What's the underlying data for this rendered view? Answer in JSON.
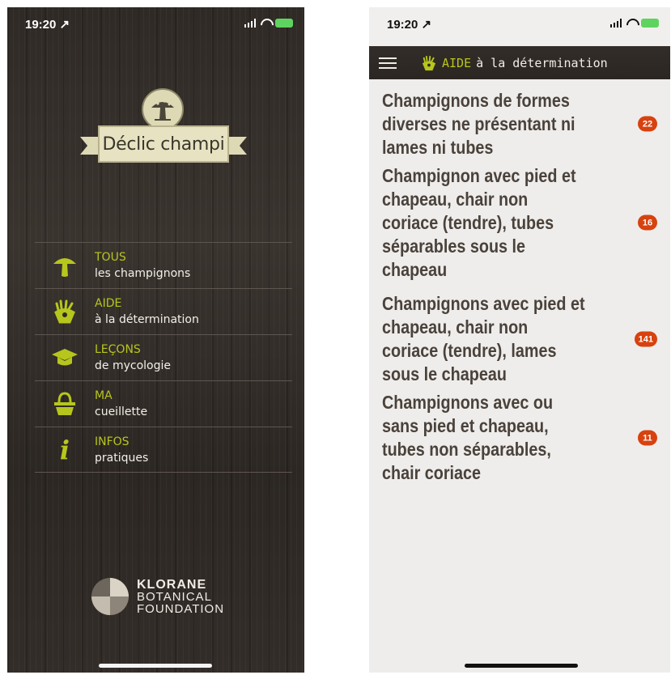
{
  "left_screen": {
    "status_bar": {
      "time": "19:20 ↗"
    },
    "brand": {
      "title": "Déclic champi"
    },
    "menu": [
      {
        "title": "TOUS",
        "subtitle": "les champignons",
        "icon": "mushroom-icon"
      },
      {
        "title": "AIDE",
        "subtitle": "à la détermination",
        "icon": "hand-icon"
      },
      {
        "title": "LEÇONS",
        "subtitle": "de mycologie",
        "icon": "graduation-cap-icon"
      },
      {
        "title": "MA",
        "subtitle": "cueillette",
        "icon": "basket-icon"
      },
      {
        "title": "INFOS",
        "subtitle": "pratiques",
        "icon": "info-icon"
      }
    ],
    "footer": {
      "line1": "KLORANE",
      "line2": "BOTANICAL",
      "line3": "FOUNDATION"
    }
  },
  "right_screen": {
    "status_bar": {
      "time": "19:20 ↗"
    },
    "header": {
      "title_accent": "AIDE",
      "title_rest": "à la détermination"
    },
    "items": [
      {
        "label": "Champignons de formes diverses ne présentant ni lames ni tubes",
        "count": "22"
      },
      {
        "label": "Champignon avec pied et chapeau, chair non coriace (tendre), tubes séparables sous le chapeau",
        "count": "16"
      },
      {
        "label": "Champignons avec pied et chapeau, chair non coriace (tendre), lames sous le chapeau",
        "count": "141"
      },
      {
        "label": "Champignons avec ou sans pied et chapeau, tubes non séparables, chair coriace",
        "count": "11"
      }
    ]
  },
  "colors": {
    "accent_green": "#b6c61c",
    "badge_orange": "#d7420f",
    "wood_dark": "#2f2a26",
    "paper": "#eeedeb"
  }
}
